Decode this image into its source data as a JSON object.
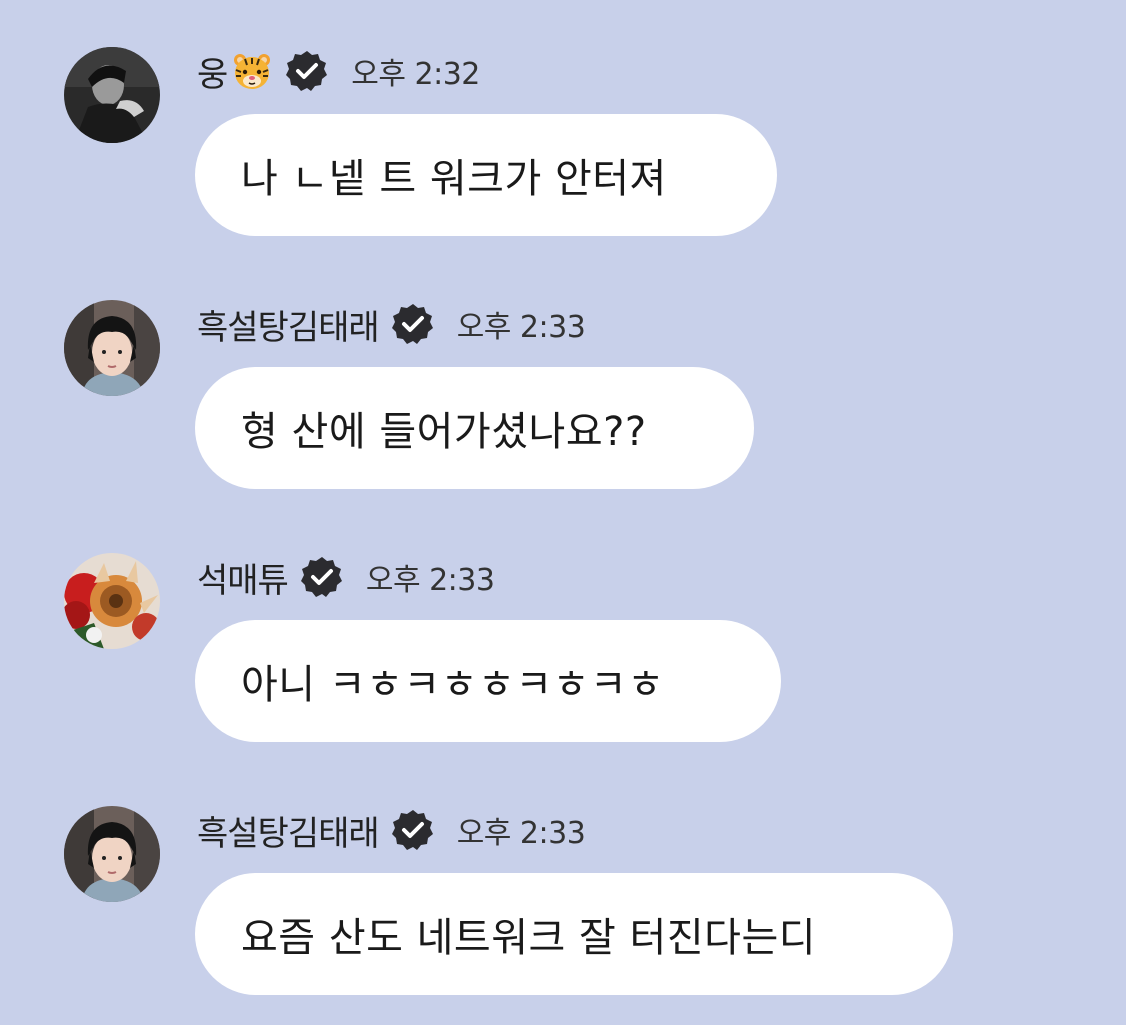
{
  "messages": [
    {
      "sender": "웅",
      "sender_emoji": "tiger-face-emoji",
      "verified": true,
      "time": "오후 2:32",
      "text": "나 ㄴ넽 트 워크가 안터져",
      "avatar": "grayscale-portrait"
    },
    {
      "sender": "흑설탕김태래",
      "verified": true,
      "time": "오후 2:33",
      "text": "형 산에 들어가셨나요??",
      "avatar": "selfie-dark-hair"
    },
    {
      "sender": "석매튜",
      "verified": true,
      "time": "오후 2:33",
      "text": "아니 ㅋㅎㅋㅎㅎㅋㅎㅋㅎ",
      "avatar": "red-flowers"
    },
    {
      "sender": "흑설탕김태래",
      "verified": true,
      "time": "오후 2:33",
      "text": "요즘 산도 네트워크 잘 터진다는디",
      "avatar": "selfie-dark-hair"
    }
  ],
  "colors": {
    "background": "#c8d0ea",
    "bubble": "#ffffff",
    "verified_badge": "#2b2b2f",
    "text": "#1a1a1a"
  }
}
